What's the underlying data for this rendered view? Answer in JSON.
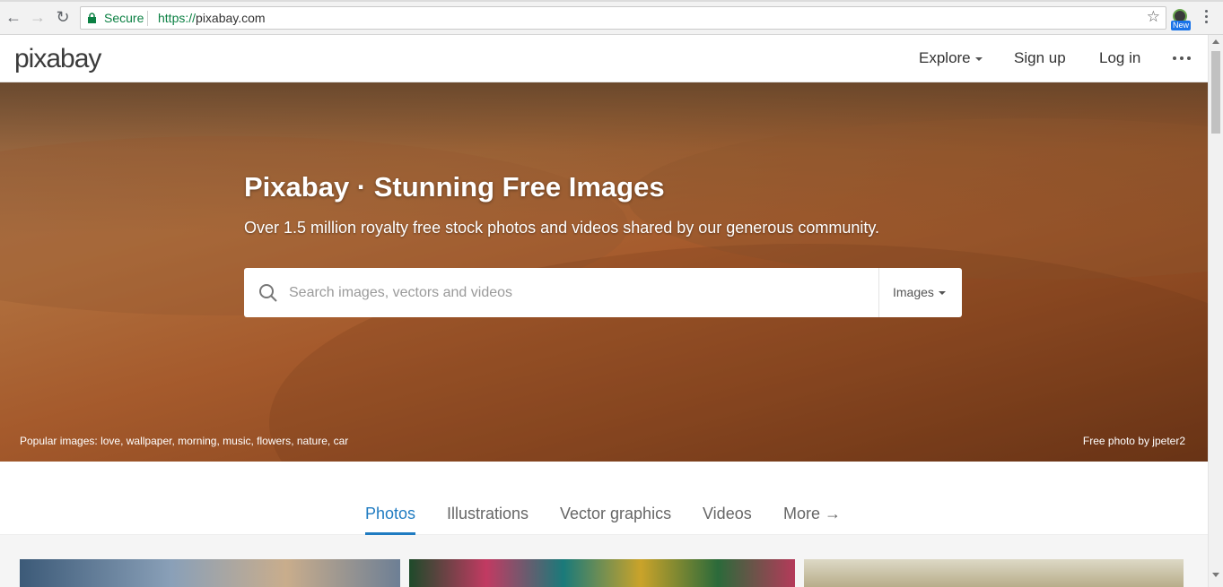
{
  "browser": {
    "secure_label": "Secure",
    "url_scheme": "https://",
    "url_host": "pixabay.com",
    "extension_badge": "New"
  },
  "header": {
    "logo": "pixabay",
    "nav": {
      "explore": "Explore",
      "signup": "Sign up",
      "login": "Log in"
    }
  },
  "hero": {
    "title": "Pixabay · Stunning Free Images",
    "subtitle": "Over 1.5 million royalty free stock photos and videos shared by our generous community.",
    "search_placeholder": "Search images, vectors and videos",
    "search_type": "Images",
    "popular_label": "Popular images:",
    "popular_items": [
      "love",
      "wallpaper",
      "morning",
      "music",
      "flowers",
      "nature",
      "car"
    ],
    "credit": "Free photo by jpeter2"
  },
  "tabs": [
    {
      "label": "Photos",
      "active": true
    },
    {
      "label": "Illustrations",
      "active": false
    },
    {
      "label": "Vector graphics",
      "active": false
    },
    {
      "label": "Videos",
      "active": false
    },
    {
      "label": "More →",
      "active": false
    }
  ],
  "colors": {
    "accent": "#1f7bc1",
    "secure_green": "#0b8043"
  }
}
